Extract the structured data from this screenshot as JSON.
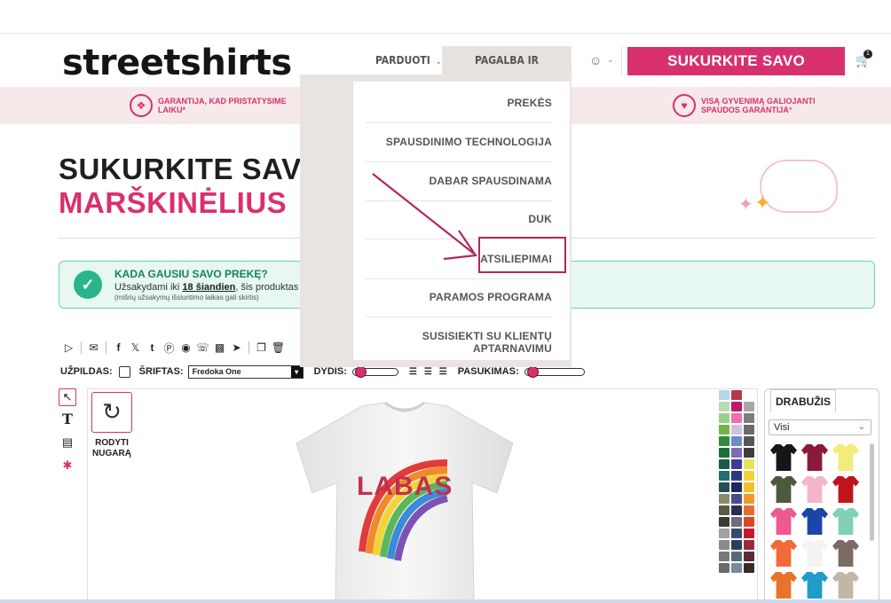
{
  "header": {
    "logo": "streetshirts",
    "nav": [
      {
        "label": "PARDUOTI",
        "caret": "⌄"
      },
      {
        "label": "PAGALBA IR INFORMACIJA",
        "caret": "⌃"
      }
    ],
    "cta_label": "SUKURKITE SAVO MARŠKINĖLIUS",
    "cart_count": "1"
  },
  "banner": {
    "left_text": "GARANTIJA, KAD PRISTATYSIME LAIKU*",
    "right_text": "VISĄ GYVENIMĄ GALIOJANTI SPAUDOS GARANTIJA°"
  },
  "hero": {
    "line1": "SUKURKITE SAVO",
    "line2": "MARŠKINĖLIUS"
  },
  "info": {
    "title": "KADA GAUSIU SAVO PREKĘ?",
    "text_before": "Užsakydami iki",
    "text_link": "18 šiandien",
    "text_after": ", šis produktas (",
    "small": "(mišrių užsakymų išsiuntimo laikas gali skirtis)"
  },
  "props": {
    "fill_label": "UŽPILDAS:",
    "font_label": "ŠRIFTAS:",
    "font_value": "Fredoka One",
    "size_label": "DYDIS:",
    "rotate_label": "PASUKIMAS:"
  },
  "designer": {
    "back_label": "RODYTI NUGARĄ",
    "shirt_text": "LABAS"
  },
  "apparel": {
    "tab_label": "DRABUŽIS",
    "filter_value": "Visi",
    "items": [
      {
        "color": "#15151a"
      },
      {
        "color": "#8b1a3a"
      },
      {
        "color": "#f2ec7a"
      },
      {
        "color": "#4b5a3c"
      },
      {
        "color": "#f5b5c8"
      },
      {
        "color": "#c0141d"
      },
      {
        "color": "#ec5a8f"
      },
      {
        "color": "#1b46a8"
      },
      {
        "color": "#7fd3b4"
      },
      {
        "color": "#f26a37"
      },
      {
        "color": "#f3f3f3"
      },
      {
        "color": "#7c6b63"
      },
      {
        "color": "#e8742a"
      },
      {
        "color": "#1e9dc9"
      },
      {
        "color": "#c4b6a6"
      }
    ]
  },
  "swatches": [
    "#b8d4e8",
    "#b23a4d",
    "#ffffff",
    "#b9ddb0",
    "#c0186a",
    "#a8a8a8",
    "#9ad08a",
    "#ee6fa9",
    "#7d7d7d",
    "#76b24a",
    "#cfc0e3",
    "#6a6a6a",
    "#2f8b3b",
    "#6b8cc9",
    "#555555",
    "#1f6f3d",
    "#7e6bb8",
    "#3f3f3f",
    "#1b5a47",
    "#3d3a9a",
    "#e7e45a",
    "#1f6f75",
    "#2a3a7a",
    "#f0d33a",
    "#254f57",
    "#1e2a5a",
    "#f2c02a",
    "#8f8a6a",
    "#474f8a",
    "#f09a2a",
    "#5b5a4a",
    "#2b2f4f",
    "#ea6c2a",
    "#3a3a32",
    "#6e6e7a",
    "#d9482a",
    "#a0a0a0",
    "#3a4a6a",
    "#c41a2a",
    "#8a8a8a",
    "#2d3d5d",
    "#9a2a3a",
    "#7a7a7a",
    "#5a6a7a",
    "#5a2a3a",
    "#6a6a6a",
    "#7a8a9a",
    "#3a2a2a"
  ],
  "dropdown": {
    "items": [
      "PREKĖS",
      "SPAUSDINIMO TECHNOLOGIJA",
      "DABAR SPAUSDINAMA",
      "DUK",
      "ATSILIEPIMAI",
      "PARAMOS PROGRAMA",
      "SUSISIEKTI SU KLIENTŲ APTARNAVIMU"
    ],
    "highlighted": "ATSILIEPIMAI",
    "annotation_color": "#b0275f"
  }
}
